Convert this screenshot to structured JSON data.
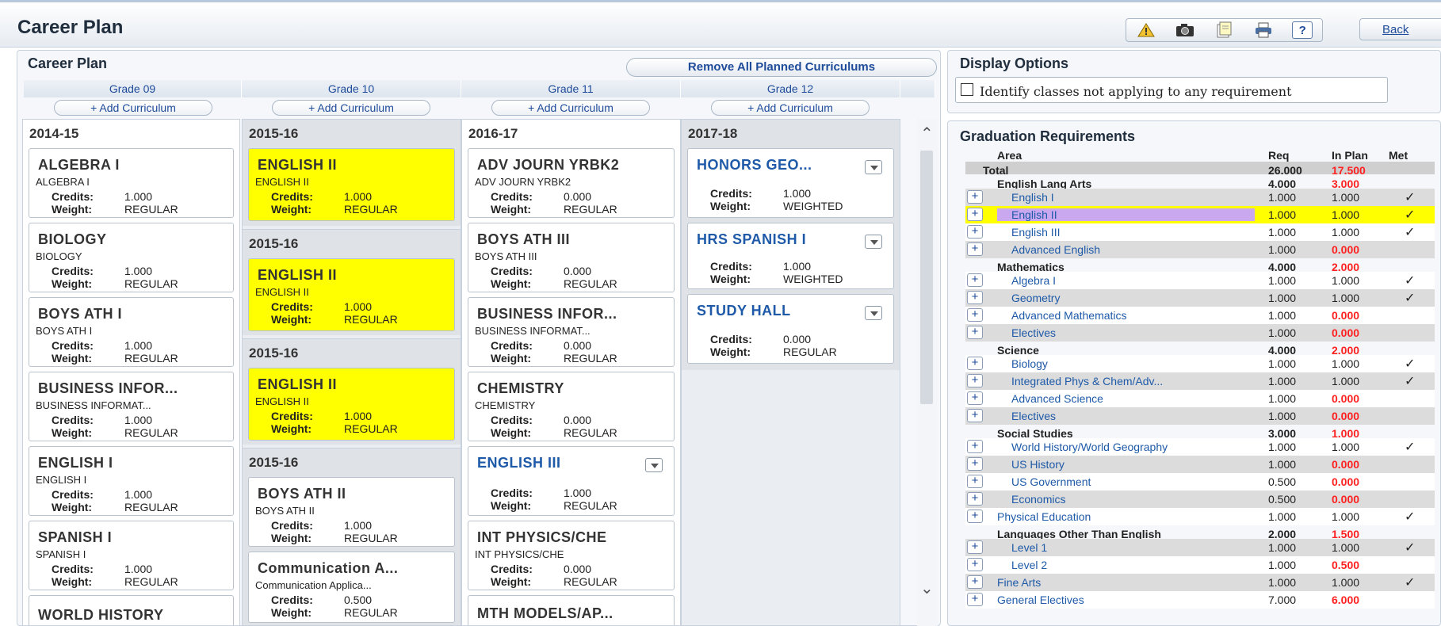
{
  "app": {
    "title": "Career Plan",
    "back_label": "Back"
  },
  "toolbar": {
    "help_label": "?"
  },
  "career_plan": {
    "title": "Career Plan",
    "remove_all_label": "Remove All Planned Curriculums",
    "add_label": "+ Add Curriculum",
    "labels": {
      "credits": "Credits:",
      "weight": "Weight:"
    },
    "grades": [
      {
        "label": "Grade 09",
        "year": "2014-15"
      },
      {
        "label": "Grade 10",
        "groups": [
          {
            "year": "2015-16"
          },
          {
            "year": "2015-16"
          },
          {
            "year": "2015-16"
          },
          {
            "year": "2015-16"
          }
        ]
      },
      {
        "label": "Grade 11",
        "year": "2016-17"
      },
      {
        "label": "Grade 12",
        "year": "2017-18"
      }
    ],
    "g09": [
      {
        "title": "ALGEBRA I",
        "sub": "ALGEBRA I",
        "credits": "1.000",
        "weight": "REGULAR"
      },
      {
        "title": "BIOLOGY",
        "sub": "BIOLOGY",
        "credits": "1.000",
        "weight": "REGULAR"
      },
      {
        "title": "BOYS ATH I",
        "sub": "BOYS ATH I",
        "credits": "1.000",
        "weight": "REGULAR"
      },
      {
        "title": "BUSINESS INFOR...",
        "sub": "BUSINESS INFORMAT...",
        "credits": "1.000",
        "weight": "REGULAR"
      },
      {
        "title": "ENGLISH I",
        "sub": "ENGLISH I",
        "credits": "1.000",
        "weight": "REGULAR"
      },
      {
        "title": "SPANISH I",
        "sub": "SPANISH I",
        "credits": "1.000",
        "weight": "REGULAR"
      },
      {
        "title": "WORLD HISTORY"
      }
    ],
    "g10": [
      {
        "title": "ENGLISH II",
        "sub": "ENGLISH II",
        "credits": "1.000",
        "weight": "REGULAR"
      },
      {
        "title": "ENGLISH II",
        "sub": "ENGLISH II",
        "credits": "1.000",
        "weight": "REGULAR"
      },
      {
        "title": "ENGLISH II",
        "sub": "ENGLISH II",
        "credits": "1.000",
        "weight": "REGULAR"
      },
      {
        "title": "BOYS ATH II",
        "sub": "BOYS ATH II",
        "credits": "1.000",
        "weight": "REGULAR"
      },
      {
        "title": "Communication A...",
        "sub": "Communication Applica...",
        "credits": "0.500",
        "weight": "REGULAR"
      }
    ],
    "g11": [
      {
        "title": "ADV JOURN YRBK2",
        "sub": "ADV JOURN YRBK2",
        "credits": "0.000",
        "weight": "REGULAR"
      },
      {
        "title": "BOYS ATH III",
        "sub": "BOYS ATH III",
        "credits": "0.000",
        "weight": "REGULAR"
      },
      {
        "title": "BUSINESS INFOR...",
        "sub": "BUSINESS INFORMAT...",
        "credits": "0.000",
        "weight": "REGULAR"
      },
      {
        "title": "CHEMISTRY",
        "sub": "CHEMISTRY",
        "credits": "0.000",
        "weight": "REGULAR"
      },
      {
        "title": "ENGLISH III",
        "credits": "1.000",
        "weight": "REGULAR"
      },
      {
        "title": "INT PHYSICS/CHE",
        "sub": "INT PHYSICS/CHE",
        "credits": "0.000",
        "weight": "REGULAR"
      },
      {
        "title": "MTH MODELS/AP..."
      }
    ],
    "g12": [
      {
        "title": "HONORS GEO...",
        "credits": "1.000",
        "weight": "WEIGHTED"
      },
      {
        "title": "HRS SPANISH I",
        "credits": "1.000",
        "weight": "WEIGHTED"
      },
      {
        "title": "STUDY HALL",
        "credits": "0.000",
        "weight": "REGULAR"
      }
    ]
  },
  "display_options": {
    "title": "Display Options",
    "identify_label": "Identify classes not applying to any requirement"
  },
  "grad": {
    "title": "Graduation Requirements",
    "headers": {
      "area": "Area",
      "req": "Req",
      "inplan": "In Plan",
      "met": "Met"
    },
    "plus": "+",
    "check": "✓",
    "rows": [
      {
        "area": "Total",
        "req": "26.000",
        "inplan": "17.500"
      },
      {
        "area": "English Lang Arts",
        "req": "4.000",
        "inplan": "3.000"
      },
      {
        "area": "English I",
        "req": "1.000",
        "inplan": "1.000"
      },
      {
        "area": "English II",
        "req": "1.000",
        "inplan": "1.000"
      },
      {
        "area": "English III",
        "req": "1.000",
        "inplan": "1.000"
      },
      {
        "area": "Advanced English",
        "req": "1.000",
        "inplan": "0.000"
      },
      {
        "area": "Mathematics",
        "req": "4.000",
        "inplan": "2.000"
      },
      {
        "area": "Algebra I",
        "req": "1.000",
        "inplan": "1.000"
      },
      {
        "area": "Geometry",
        "req": "1.000",
        "inplan": "1.000"
      },
      {
        "area": "Advanced Mathematics",
        "req": "1.000",
        "inplan": "0.000"
      },
      {
        "area": "Electives",
        "req": "1.000",
        "inplan": "0.000"
      },
      {
        "area": "Science",
        "req": "4.000",
        "inplan": "2.000"
      },
      {
        "area": "Biology",
        "req": "1.000",
        "inplan": "1.000"
      },
      {
        "area": "Integrated Phys & Chem/Adv...",
        "req": "1.000",
        "inplan": "1.000"
      },
      {
        "area": "Advanced Science",
        "req": "1.000",
        "inplan": "0.000"
      },
      {
        "area": "Electives",
        "req": "1.000",
        "inplan": "0.000"
      },
      {
        "area": "Social Studies",
        "req": "3.000",
        "inplan": "1.000"
      },
      {
        "area": "World History/World Geography",
        "req": "1.000",
        "inplan": "1.000"
      },
      {
        "area": "US History",
        "req": "1.000",
        "inplan": "0.000"
      },
      {
        "area": "US Government",
        "req": "0.500",
        "inplan": "0.000"
      },
      {
        "area": "Economics",
        "req": "0.500",
        "inplan": "0.000"
      },
      {
        "area": "Physical Education",
        "req": "1.000",
        "inplan": "1.000"
      },
      {
        "area": "Languages Other Than English",
        "req": "2.000",
        "inplan": "1.500"
      },
      {
        "area": "Level 1",
        "req": "1.000",
        "inplan": "1.000"
      },
      {
        "area": "Level 2",
        "req": "1.000",
        "inplan": "0.500"
      },
      {
        "area": "Fine Arts",
        "req": "1.000",
        "inplan": "1.000"
      },
      {
        "area": "General Electives",
        "req": "7.000",
        "inplan": "6.000"
      }
    ]
  }
}
